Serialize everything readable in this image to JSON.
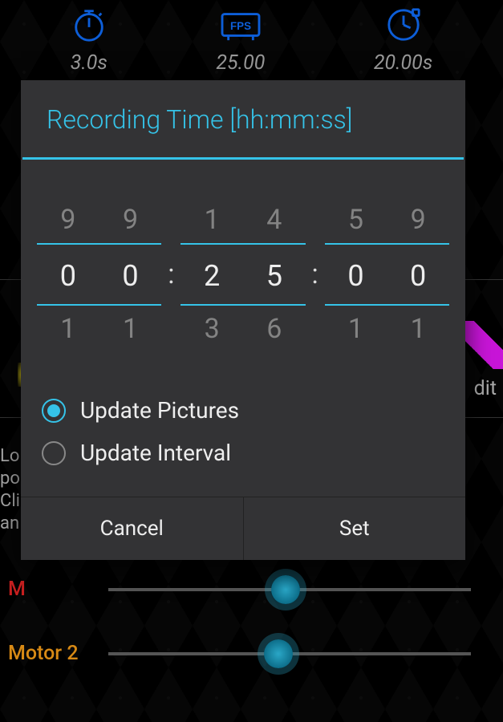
{
  "top_stats": {
    "stopwatch": "3.0s",
    "fps": "25.00",
    "clock": "20.00s"
  },
  "background": {
    "left_text_lines": [
      "Lo",
      "po",
      "Cli",
      "an"
    ],
    "edit_label": "dit",
    "motor1_label": "M",
    "motor2_label": "Motor 2"
  },
  "dialog": {
    "title": "Recording Time [hh:mm:ss]",
    "picker": {
      "hh": {
        "above": [
          "9",
          "9"
        ],
        "current": [
          "0",
          "0"
        ],
        "below": [
          "1",
          "1"
        ]
      },
      "mm": {
        "above": [
          "1",
          "4"
        ],
        "current": [
          "2",
          "5"
        ],
        "below": [
          "3",
          "6"
        ]
      },
      "ss": {
        "above": [
          "5",
          "9"
        ],
        "current": [
          "0",
          "0"
        ],
        "below": [
          "1",
          "1"
        ]
      },
      "sep": ":"
    },
    "radios": {
      "update_pictures": "Update Pictures",
      "update_interval": "Update Interval"
    },
    "buttons": {
      "cancel": "Cancel",
      "set": "Set"
    }
  }
}
